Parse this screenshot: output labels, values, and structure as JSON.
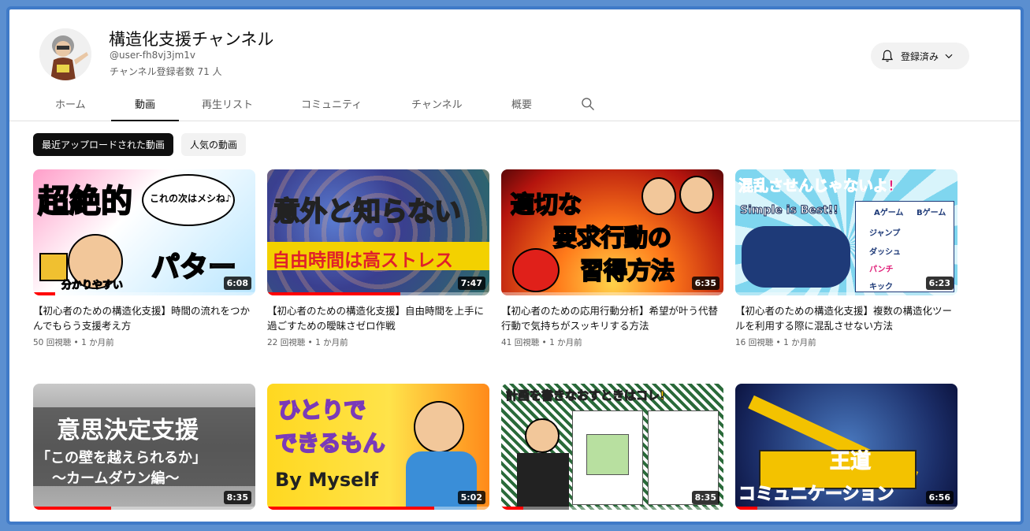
{
  "channel": {
    "title": "構造化支援チャンネル",
    "handle": "@user-fh8vj3jm1v",
    "subscribers": "チャンネル登録者数 71 人",
    "subscribe_label": "登録済み"
  },
  "tabs": [
    {
      "label": "ホーム"
    },
    {
      "label": "動画",
      "active": true
    },
    {
      "label": "再生リスト"
    },
    {
      "label": "コミュニティ"
    },
    {
      "label": "チャンネル"
    },
    {
      "label": "概要"
    }
  ],
  "chips": [
    {
      "label": "最近アップロードされた動画",
      "active": true
    },
    {
      "label": "人気の動画"
    }
  ],
  "videos": [
    {
      "title": "【初心者のための構造化支援】時間の流れをつかんでもらう支援考え方",
      "views": "50 回視聴",
      "age": "1 か月前",
      "duration": "6:08",
      "progress": 0.1,
      "thumb_texts": [
        "超絶的",
        "パターン",
        "これの次はメシね♪",
        "分かりやすい"
      ]
    },
    {
      "title": "【初心者のための構造化支援】自由時間を上手に過ごすための曖昧さゼロ作戦",
      "views": "22 回視聴",
      "age": "1 か月前",
      "duration": "7:47",
      "progress": 0.6,
      "thumb_texts": [
        "意外と知らない",
        "自由時間は高ストレス"
      ]
    },
    {
      "title": "【初心者のための応用行動分析】希望が叶う代替行動で気持ちがスッキリする方法",
      "views": "41 回視聴",
      "age": "1 か月前",
      "duration": "6:35",
      "progress": 0.0,
      "thumb_texts": [
        "適切な",
        "要求行動の",
        "習得方法"
      ]
    },
    {
      "title": "【初心者のための構造化支援】複数の構造化ツールを利用する際に混乱させない方法",
      "views": "16 回視聴",
      "age": "1 か月前",
      "duration": "6:23",
      "progress": 0.0,
      "thumb_texts": [
        "混乱させんじゃないよ!",
        "Simple is Best!!",
        "Aゲーム",
        "Bゲーム",
        "ジャンプ",
        "ダッシュ",
        "パンチ",
        "キック"
      ]
    },
    {
      "duration": "8:35",
      "progress": 0.35,
      "thumb_texts": [
        "意思決定支援",
        "「この壁を越えられるか」",
        "～カームダウン編～"
      ]
    },
    {
      "duration": "5:02",
      "progress": 0.75,
      "thumb_texts": [
        "ひとりで",
        "できるもん",
        "By Myself"
      ]
    },
    {
      "duration": "8:35",
      "progress": 0.1,
      "thumb_texts": [
        "計画を書きなおすときはコレ!"
      ]
    },
    {
      "duration": "6:56",
      "progress": 0.1,
      "thumb_texts": [
        "王道",
        "コミュニケーション"
      ]
    }
  ],
  "colors": {
    "frame_border": "#3f7ac7",
    "progress": "#ff0000"
  }
}
